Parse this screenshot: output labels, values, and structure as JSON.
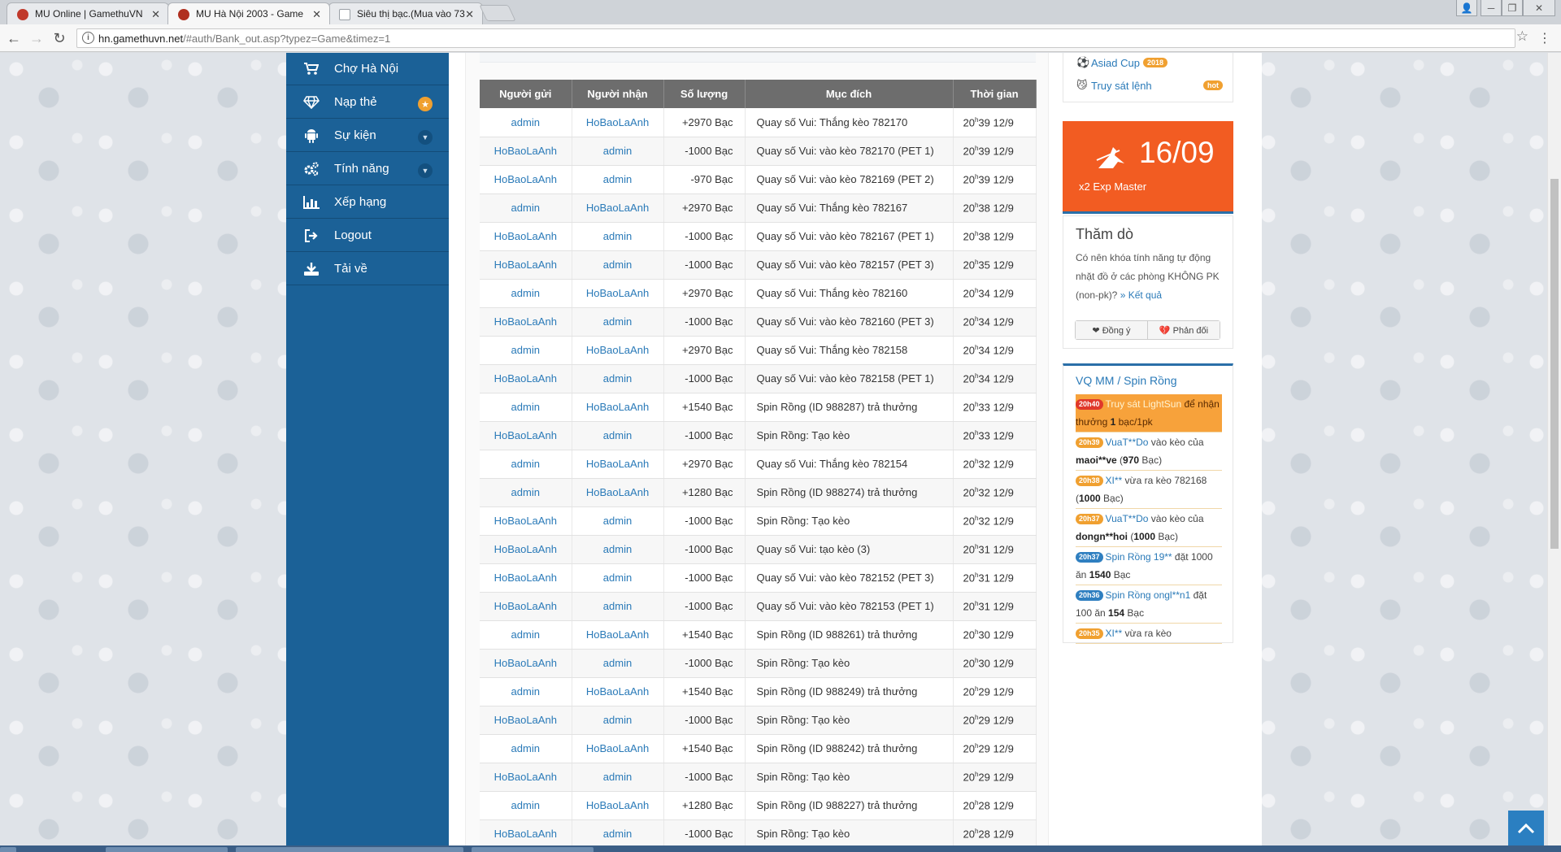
{
  "browser": {
    "tabs": [
      {
        "title": "MU Online | GamethuVN",
        "favicon_color": "#c0392b"
      },
      {
        "title": "MU Hà Nội 2003 - Game",
        "favicon_color": "#b03020"
      },
      {
        "title": "Siêu thị bạc.(Mua vào 73",
        "favicon_color": "#9aa0a6"
      }
    ],
    "url_host": "hn.gamethuvn.net",
    "url_path": "/#auth/Bank_out.asp?typez=Game&timez=1"
  },
  "sidebar": {
    "items": [
      {
        "label": "Chợ Hà Nội",
        "icon": "cart-icon",
        "glyph": "🛒"
      },
      {
        "label": "Nạp thẻ",
        "icon": "diamond-icon",
        "glyph": "◈",
        "badge": "★"
      },
      {
        "label": "Sự kiện",
        "icon": "android-icon",
        "glyph": "◆",
        "chevron": "▼"
      },
      {
        "label": "Tính năng",
        "icon": "cogs-icon",
        "glyph": "⚙",
        "chevron": "▼"
      },
      {
        "label": "Xếp hạng",
        "icon": "bar-chart-icon",
        "glyph": "▥"
      },
      {
        "label": "Logout",
        "icon": "sign-out-icon",
        "glyph": "⇥"
      },
      {
        "label": "Tải về",
        "icon": "download-icon",
        "glyph": "⤓"
      }
    ]
  },
  "table": {
    "headers": [
      "Người gửi",
      "Người nhận",
      "Số lượng",
      "Mục đích",
      "Thời gian"
    ],
    "rows": [
      {
        "from": "admin",
        "to": "HoBaoLaAnh",
        "amount": "+2970  Bạc",
        "purpose": "Quay số Vui: Thắng kèo 782170",
        "time_h": "20",
        "time_m": "39 12/9"
      },
      {
        "from": "HoBaoLaAnh",
        "to": "admin",
        "amount": "-1000  Bạc",
        "purpose": "Quay số Vui: vào kèo 782170 (PET 1)",
        "time_h": "20",
        "time_m": "39 12/9"
      },
      {
        "from": "HoBaoLaAnh",
        "to": "admin",
        "amount": "-970  Bạc",
        "purpose": "Quay số Vui: vào kèo 782169 (PET 2)",
        "time_h": "20",
        "time_m": "39 12/9"
      },
      {
        "from": "admin",
        "to": "HoBaoLaAnh",
        "amount": "+2970  Bạc",
        "purpose": "Quay số Vui: Thắng kèo 782167",
        "time_h": "20",
        "time_m": "38 12/9"
      },
      {
        "from": "HoBaoLaAnh",
        "to": "admin",
        "amount": "-1000  Bạc",
        "purpose": "Quay số Vui: vào kèo 782167 (PET 1)",
        "time_h": "20",
        "time_m": "38 12/9"
      },
      {
        "from": "HoBaoLaAnh",
        "to": "admin",
        "amount": "-1000  Bạc",
        "purpose": "Quay số Vui: vào kèo 782157 (PET 3)",
        "time_h": "20",
        "time_m": "35 12/9"
      },
      {
        "from": "admin",
        "to": "HoBaoLaAnh",
        "amount": "+2970  Bạc",
        "purpose": "Quay số Vui: Thắng kèo 782160",
        "time_h": "20",
        "time_m": "34 12/9"
      },
      {
        "from": "HoBaoLaAnh",
        "to": "admin",
        "amount": "-1000  Bạc",
        "purpose": "Quay số Vui: vào kèo 782160 (PET 3)",
        "time_h": "20",
        "time_m": "34 12/9"
      },
      {
        "from": "admin",
        "to": "HoBaoLaAnh",
        "amount": "+2970  Bạc",
        "purpose": "Quay số Vui: Thắng kèo 782158",
        "time_h": "20",
        "time_m": "34 12/9"
      },
      {
        "from": "HoBaoLaAnh",
        "to": "admin",
        "amount": "-1000  Bạc",
        "purpose": "Quay số Vui: vào kèo 782158 (PET 1)",
        "time_h": "20",
        "time_m": "34 12/9"
      },
      {
        "from": "admin",
        "to": "HoBaoLaAnh",
        "amount": "+1540  Bạc",
        "purpose": "Spin Rồng (ID 988287) trả thưởng",
        "time_h": "20",
        "time_m": "33 12/9"
      },
      {
        "from": "HoBaoLaAnh",
        "to": "admin",
        "amount": "-1000  Bạc",
        "purpose": "Spin Rồng: Tạo kèo",
        "time_h": "20",
        "time_m": "33 12/9"
      },
      {
        "from": "admin",
        "to": "HoBaoLaAnh",
        "amount": "+2970  Bạc",
        "purpose": "Quay số Vui: Thắng kèo 782154",
        "time_h": "20",
        "time_m": "32 12/9"
      },
      {
        "from": "admin",
        "to": "HoBaoLaAnh",
        "amount": "+1280  Bạc",
        "purpose": "Spin Rồng (ID 988274) trả thưởng",
        "time_h": "20",
        "time_m": "32 12/9"
      },
      {
        "from": "HoBaoLaAnh",
        "to": "admin",
        "amount": "-1000  Bạc",
        "purpose": "Spin Rồng: Tạo kèo",
        "time_h": "20",
        "time_m": "32 12/9"
      },
      {
        "from": "HoBaoLaAnh",
        "to": "admin",
        "amount": "-1000  Bạc",
        "purpose": "Quay số Vui: tạo kèo (3)",
        "time_h": "20",
        "time_m": "31 12/9"
      },
      {
        "from": "HoBaoLaAnh",
        "to": "admin",
        "amount": "-1000  Bạc",
        "purpose": "Quay số Vui: vào kèo 782152 (PET 3)",
        "time_h": "20",
        "time_m": "31 12/9"
      },
      {
        "from": "HoBaoLaAnh",
        "to": "admin",
        "amount": "-1000  Bạc",
        "purpose": "Quay số Vui: vào kèo 782153 (PET 1)",
        "time_h": "20",
        "time_m": "31 12/9"
      },
      {
        "from": "admin",
        "to": "HoBaoLaAnh",
        "amount": "+1540  Bạc",
        "purpose": "Spin Rồng (ID 988261) trả thưởng",
        "time_h": "20",
        "time_m": "30 12/9"
      },
      {
        "from": "HoBaoLaAnh",
        "to": "admin",
        "amount": "-1000  Bạc",
        "purpose": "Spin Rồng: Tạo kèo",
        "time_h": "20",
        "time_m": "30 12/9"
      },
      {
        "from": "admin",
        "to": "HoBaoLaAnh",
        "amount": "+1540  Bạc",
        "purpose": "Spin Rồng (ID 988249) trả thưởng",
        "time_h": "20",
        "time_m": "29 12/9"
      },
      {
        "from": "HoBaoLaAnh",
        "to": "admin",
        "amount": "-1000  Bạc",
        "purpose": "Spin Rồng: Tạo kèo",
        "time_h": "20",
        "time_m": "29 12/9"
      },
      {
        "from": "admin",
        "to": "HoBaoLaAnh",
        "amount": "+1540  Bạc",
        "purpose": "Spin Rồng (ID 988242) trả thưởng",
        "time_h": "20",
        "time_m": "29 12/9"
      },
      {
        "from": "HoBaoLaAnh",
        "to": "admin",
        "amount": "-1000  Bạc",
        "purpose": "Spin Rồng: Tạo kèo",
        "time_h": "20",
        "time_m": "29 12/9"
      },
      {
        "from": "admin",
        "to": "HoBaoLaAnh",
        "amount": "+1280  Bạc",
        "purpose": "Spin Rồng (ID 988227) trả thưởng",
        "time_h": "20",
        "time_m": "28 12/9"
      },
      {
        "from": "HoBaoLaAnh",
        "to": "admin",
        "amount": "-1000  Bạc",
        "purpose": "Spin Rồng: Tạo kèo",
        "time_h": "20",
        "time_m": "28 12/9"
      }
    ]
  },
  "right": {
    "links": [
      {
        "label": "Asiad Cup",
        "badge": "2018",
        "badge_color": "#f0a030"
      },
      {
        "label": "Truy sát lệnh",
        "badge": "hot",
        "badge_color": "#f0a030"
      }
    ],
    "event": {
      "date": "16/09",
      "label": "x2 Exp Master"
    },
    "poll": {
      "title": "Thăm dò",
      "question": "Có nên khóa tính năng tự động nhặt đồ ở các phòng KHÔNG PK (non-pk)?",
      "result_link": "» Kết quả",
      "agree": "❤ Đồng ý",
      "disagree": "💔 Phản đối"
    },
    "vq": {
      "title": "VQ MM / Spin Rồng"
    }
  },
  "colors": {
    "sidebar": "#1b6197",
    "accent": "#2a7ab8",
    "event": "#f25c22",
    "table_header": "#6d6d6d"
  }
}
